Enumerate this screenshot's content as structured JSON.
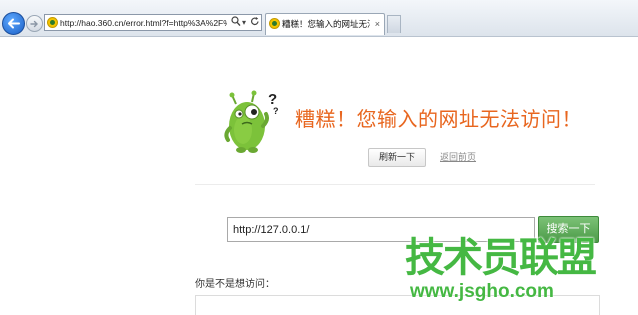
{
  "browser": {
    "address_url": "http://hao.360.cn/error.html?f=http%3A%2F%2Fl",
    "address_search_icon": "search-icon",
    "address_refresh_icon": "refresh-icon",
    "tab_title": "糟糕！您输入的网址无法访...",
    "tab_close": "×"
  },
  "error_page": {
    "question_marks": "?",
    "title": "糟糕！您输入的网址无法访问！",
    "refresh_label": "刷新一下",
    "back_link": "返回前页",
    "search_value": "http://127.0.0.1/",
    "search_button": "搜索一下",
    "suggest_label": "你是不是想访问："
  },
  "watermark": {
    "text": "技术员联盟",
    "url": "www.jsgho.com"
  },
  "colors": {
    "accent_orange": "#e8661f",
    "search_green": "#4c9b48",
    "watermark_green": "#45b843"
  }
}
